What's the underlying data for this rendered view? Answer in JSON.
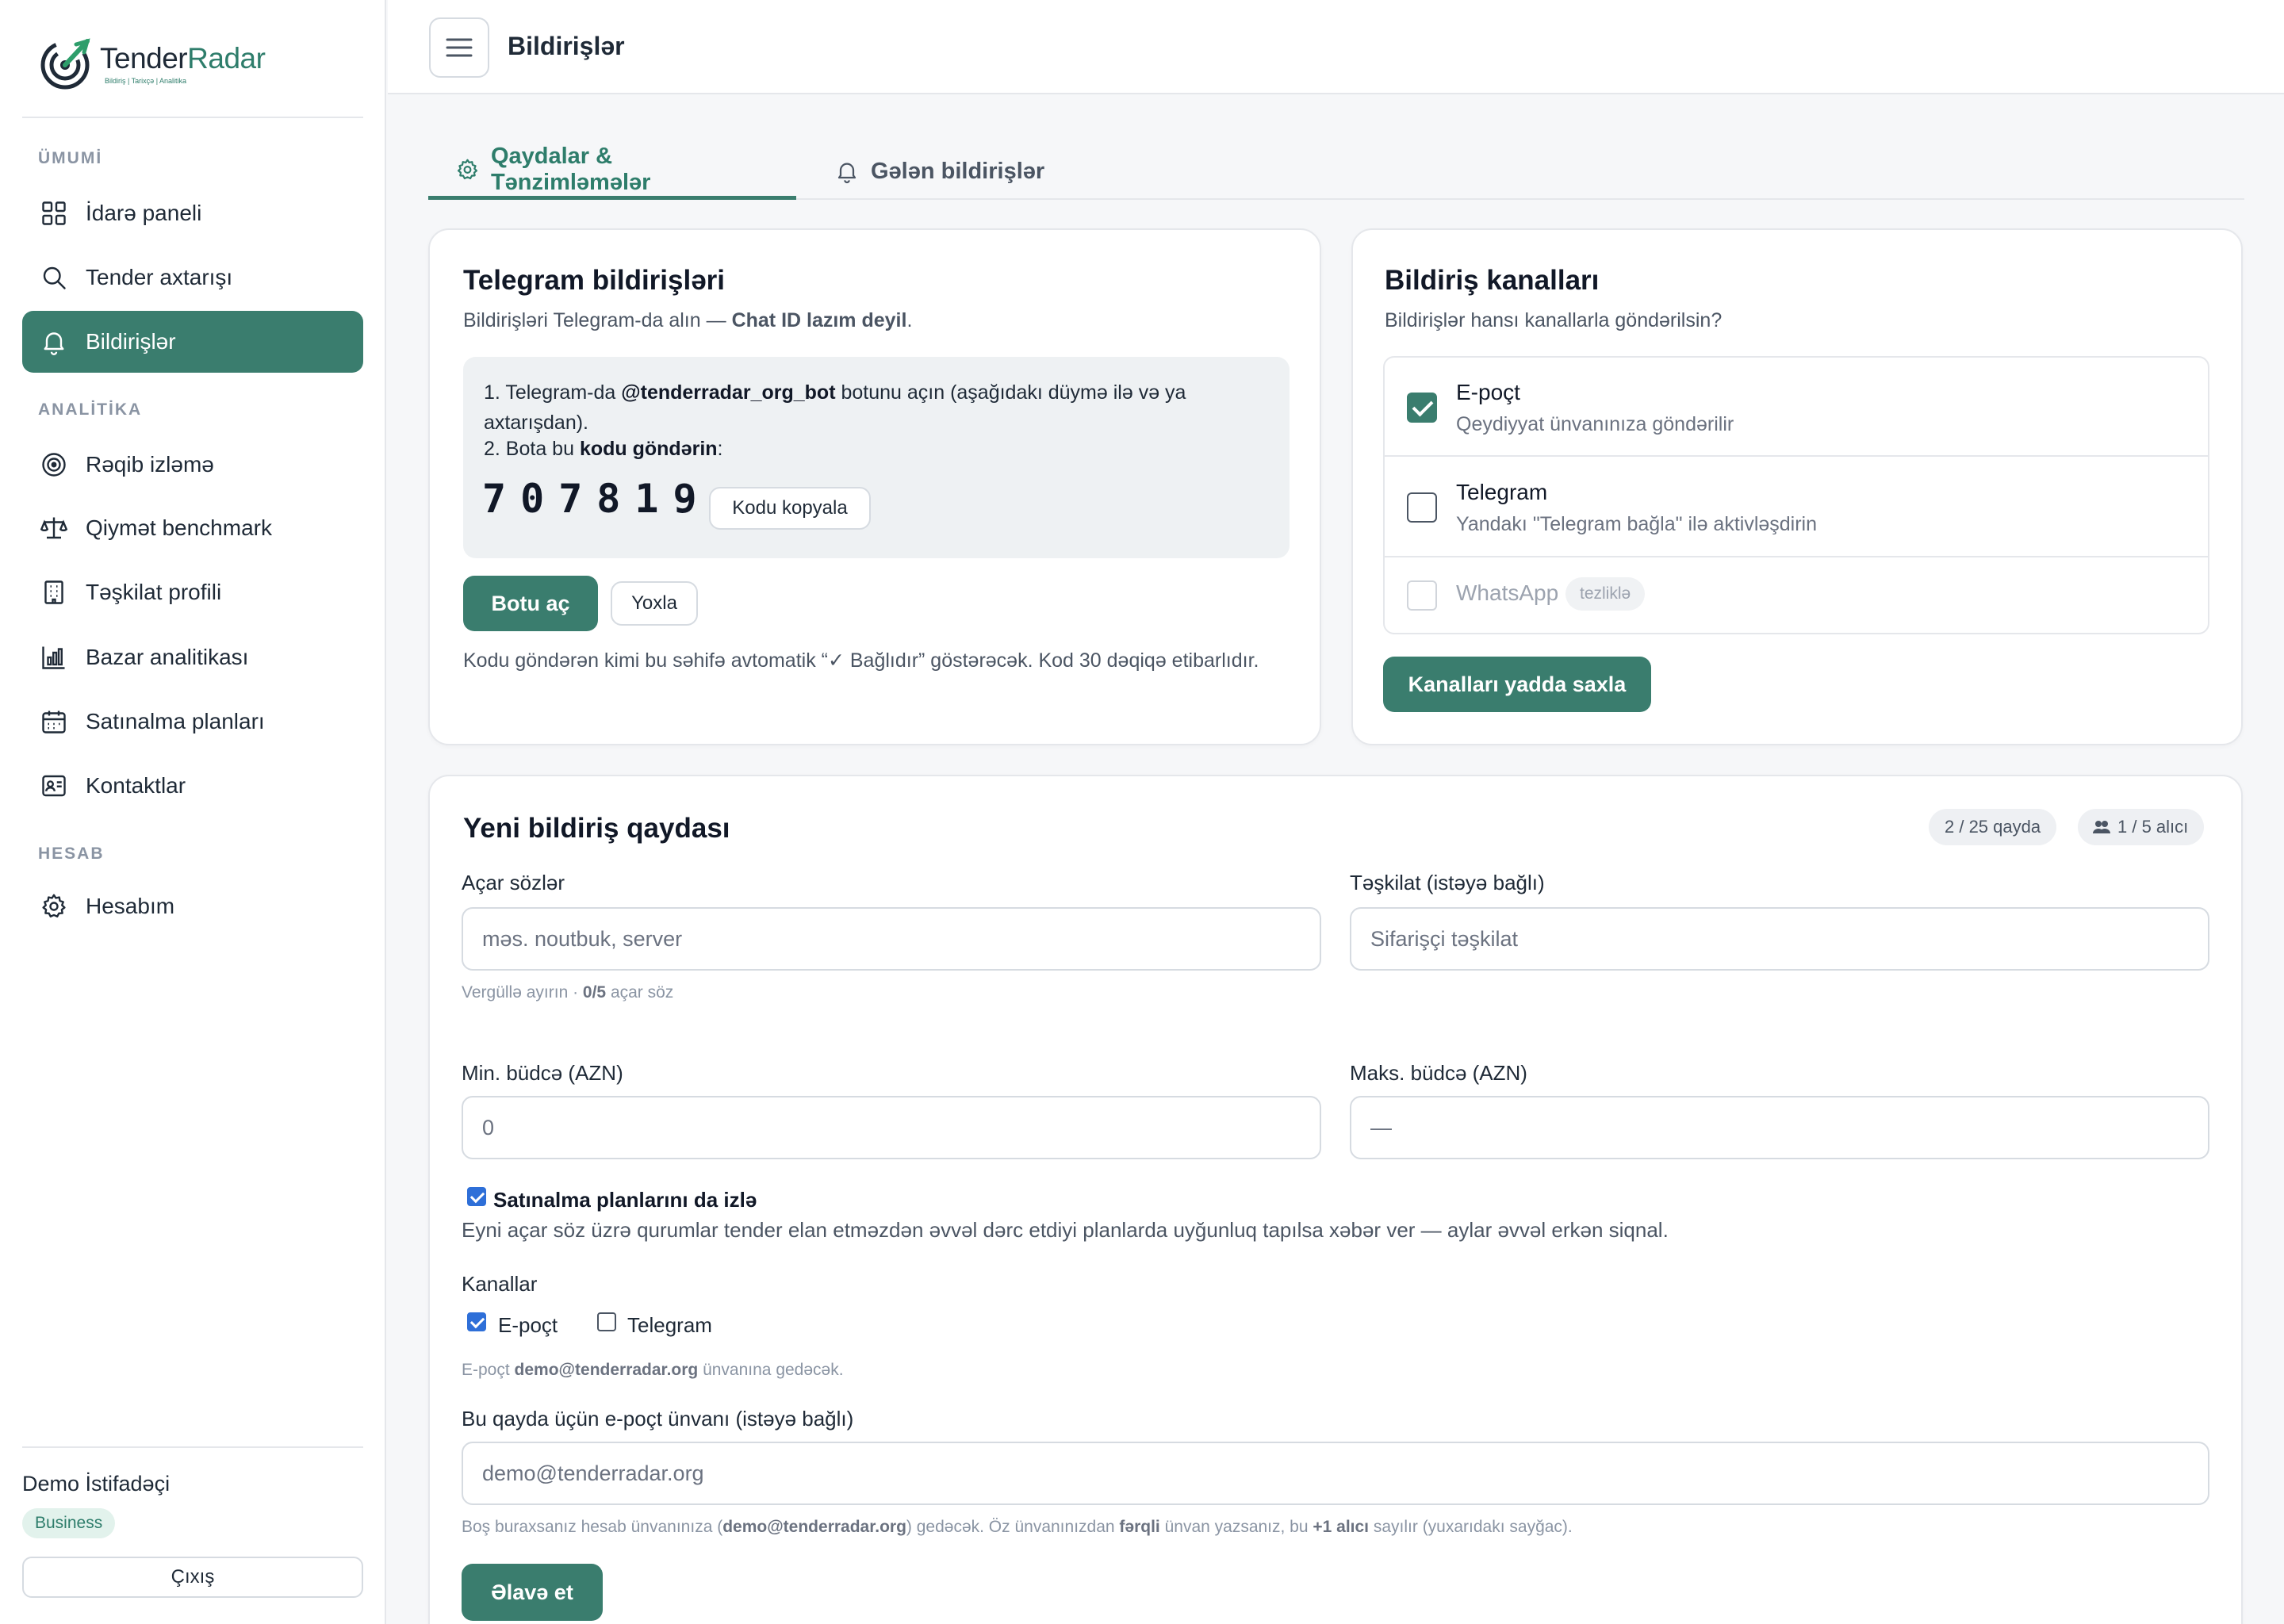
{
  "app": {
    "brand_primary": "Tender",
    "brand_accent": "Radar",
    "brand_tagline": "Bildiriş  |  Tarixçə  |  Analitika",
    "accent_color": "#3a7d6e"
  },
  "sidebar": {
    "sections": {
      "general": "ÜMUMİ",
      "analytics": "ANALİTİKA",
      "account": "HESAB"
    },
    "items": [
      {
        "label": "İdarə paneli",
        "icon": "dashboard-grid-icon"
      },
      {
        "label": "Tender axtarışı",
        "icon": "search-icon"
      },
      {
        "label": "Bildirişlər",
        "icon": "bell-icon",
        "active": true
      },
      {
        "label": "Rəqib izləmə",
        "icon": "target-icon"
      },
      {
        "label": "Qiymət benchmark",
        "icon": "scale-icon"
      },
      {
        "label": "Təşkilat profili",
        "icon": "building-icon"
      },
      {
        "label": "Bazar analitikası",
        "icon": "bar-chart-icon"
      },
      {
        "label": "Satınalma planları",
        "icon": "calendar-icon"
      },
      {
        "label": "Kontaktlar",
        "icon": "contact-card-icon"
      },
      {
        "label": "Hesabım",
        "icon": "gear-icon"
      }
    ],
    "user_name": "Demo İstifadəçi",
    "plan": "Business",
    "logout": "Çıxış"
  },
  "header": {
    "title": "Bildirişlər"
  },
  "tabs": [
    {
      "label": "Qaydalar & Tənzimləmələr",
      "active": true
    },
    {
      "label": "Gələn bildirişlər",
      "active": false
    }
  ],
  "telegram": {
    "title": "Telegram bildirişləri",
    "subtitle_prefix": "Bildirişləri Telegram-da alın — ",
    "subtitle_bold": "Chat ID lazım deyil",
    "subtitle_suffix": ".",
    "step1_prefix": "1. Telegram-da ",
    "step1_bot": "@tenderradar_org_bot",
    "step1_suffix": " botunu açın (aşağıdakı düymə ilə və ya",
    "step1_line2": "axtarışdan).",
    "step2_prefix": "2. Bota bu ",
    "step2_bold": "kodu göndərin",
    "step2_suffix": ":",
    "code": "707819",
    "copy_button": "Kodu kopyala",
    "open_bot_button": "Botu aç",
    "check_button": "Yoxla",
    "footer_note": "Kodu göndərən kimi bu səhifə avtomatik “✓ Bağlıdır” göstərəcək. Kod 30 dəqiqə etibarlıdır."
  },
  "channels": {
    "title": "Bildiriş kanalları",
    "subtitle": "Bildirişlər hansı kanallarla göndərilsin?",
    "items": [
      {
        "name": "E-poçt",
        "desc": "Qeydiyyat ünvanınıza göndərilir",
        "checked": true
      },
      {
        "name": "Telegram",
        "desc": "Yandakı \"Telegram bağla\" ilə aktivləşdirin",
        "checked": false
      },
      {
        "name": "WhatsApp",
        "badge": "tezliklə",
        "checked": false,
        "disabled": true
      }
    ],
    "save_button": "Kanalları yadda saxla"
  },
  "rule_form": {
    "title": "Yeni bildiriş qaydası",
    "rules_count": "2 / 25 qayda",
    "recipients_count": "1 / 5 alıcı",
    "keywords_label": "Açar sözlər",
    "keywords_placeholder": "məs. noutbuk, server",
    "keywords_hint_prefix": "Vergüllə ayırın · ",
    "keywords_hint_bold": "0/5",
    "keywords_hint_suffix": " açar söz",
    "org_label": "Təşkilat (istəyə bağlı)",
    "org_placeholder": "Sifarişçi təşkilat",
    "min_budget_label": "Min. büdcə (AZN)",
    "min_budget_placeholder": "0",
    "max_budget_label": "Maks. büdcə (AZN)",
    "max_budget_placeholder": "—",
    "plans_checkbox_label": "Satınalma planlarını da izlə",
    "plans_checkbox_checked": true,
    "plans_description": "Eyni açar söz üzrə qurumlar tender elan etməzdən əvvəl dərc etdiyi planlarda uyğunluq tapılsa xəbər ver — aylar əvvəl erkən siqnal.",
    "channels_label": "Kanallar",
    "channel_email": "E-poçt",
    "channel_email_checked": true,
    "channel_telegram": "Telegram",
    "channel_telegram_checked": false,
    "email_note_prefix": "E-poçt ",
    "email_note_bold": "demo@tenderradar.org",
    "email_note_suffix": " ünvanına gedəcək.",
    "rule_email_label": "Bu qayda üçün e-poçt ünvanı (istəyə bağlı)",
    "rule_email_placeholder": "demo@tenderradar.org",
    "bottom_note_1": "Boş buraxsanız hesab ünvanınıza (",
    "bottom_note_email": "demo@tenderradar.org",
    "bottom_note_2": ") gedəcək. Öz ünvanınızdan ",
    "bottom_note_bold2": "fərqli",
    "bottom_note_3": " ünvan yazsanız, bu ",
    "bottom_note_bold3": "+1 alıcı",
    "bottom_note_4": " sayılır (yuxarıdakı sayğac).",
    "add_button": "Əlavə et"
  }
}
